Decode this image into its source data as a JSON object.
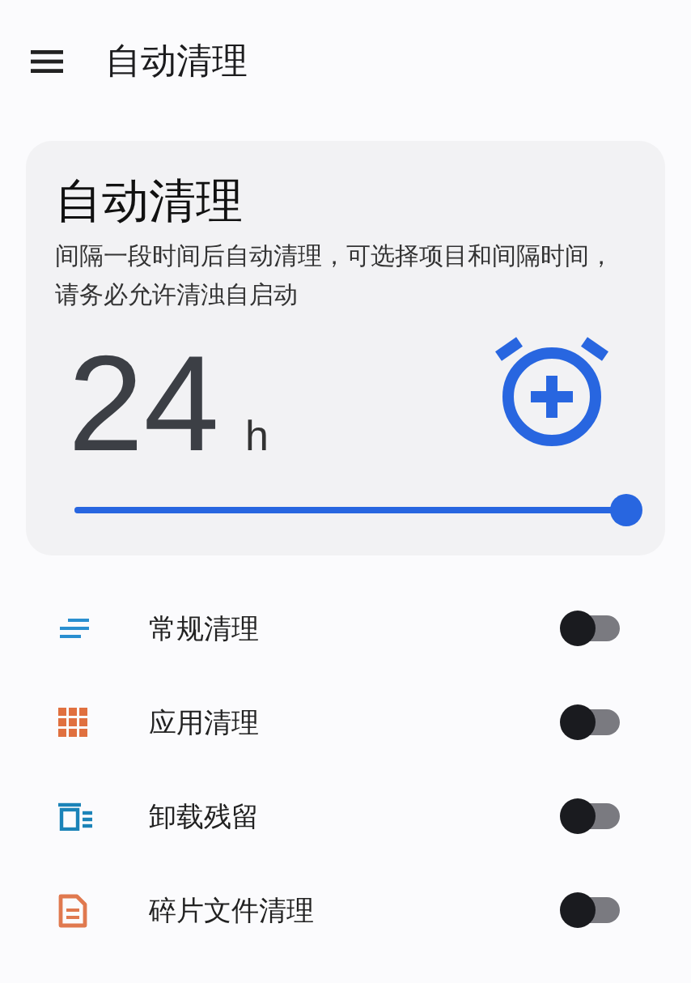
{
  "app_bar": {
    "title": "自动清理"
  },
  "card": {
    "title": "自动清理",
    "description": "间隔一段时间后自动清理，可选择项目和间隔时间，请务必允许清浊自启动",
    "value": "24",
    "unit": "h",
    "slider": {
      "level": 1
    }
  },
  "items": [
    {
      "kind": "lines",
      "label": "常规清理",
      "on": false
    },
    {
      "kind": "grid",
      "label": "应用清理",
      "on": false
    },
    {
      "kind": "trash",
      "label": "卸载残留",
      "on": false
    },
    {
      "kind": "document",
      "label": "碎片文件清理",
      "on": false
    }
  ]
}
